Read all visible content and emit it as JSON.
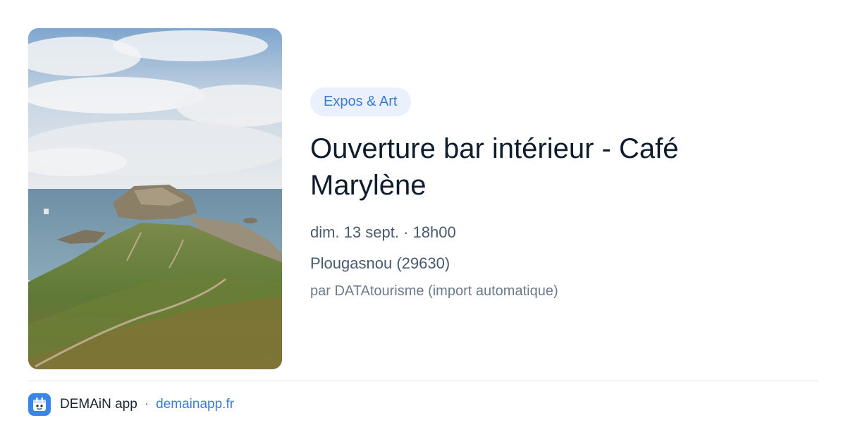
{
  "event": {
    "category": "Expos & Art",
    "title": "Ouverture bar intérieur - Café Marylène",
    "datetime": "dim. 13 sept. · 18h00",
    "location": "Plougasnou (29630)",
    "source": "par DATAtourisme (import automatique)"
  },
  "footer": {
    "app_name": "DEMAiN app",
    "separator": "·",
    "link": "demainapp.fr"
  },
  "colors": {
    "accent": "#3b7bd6",
    "tag_background": "#eaf1fc",
    "title": "#0f1c2e",
    "icon_background": "#3a86e8"
  },
  "icons": {
    "app": "demain-app-icon"
  }
}
